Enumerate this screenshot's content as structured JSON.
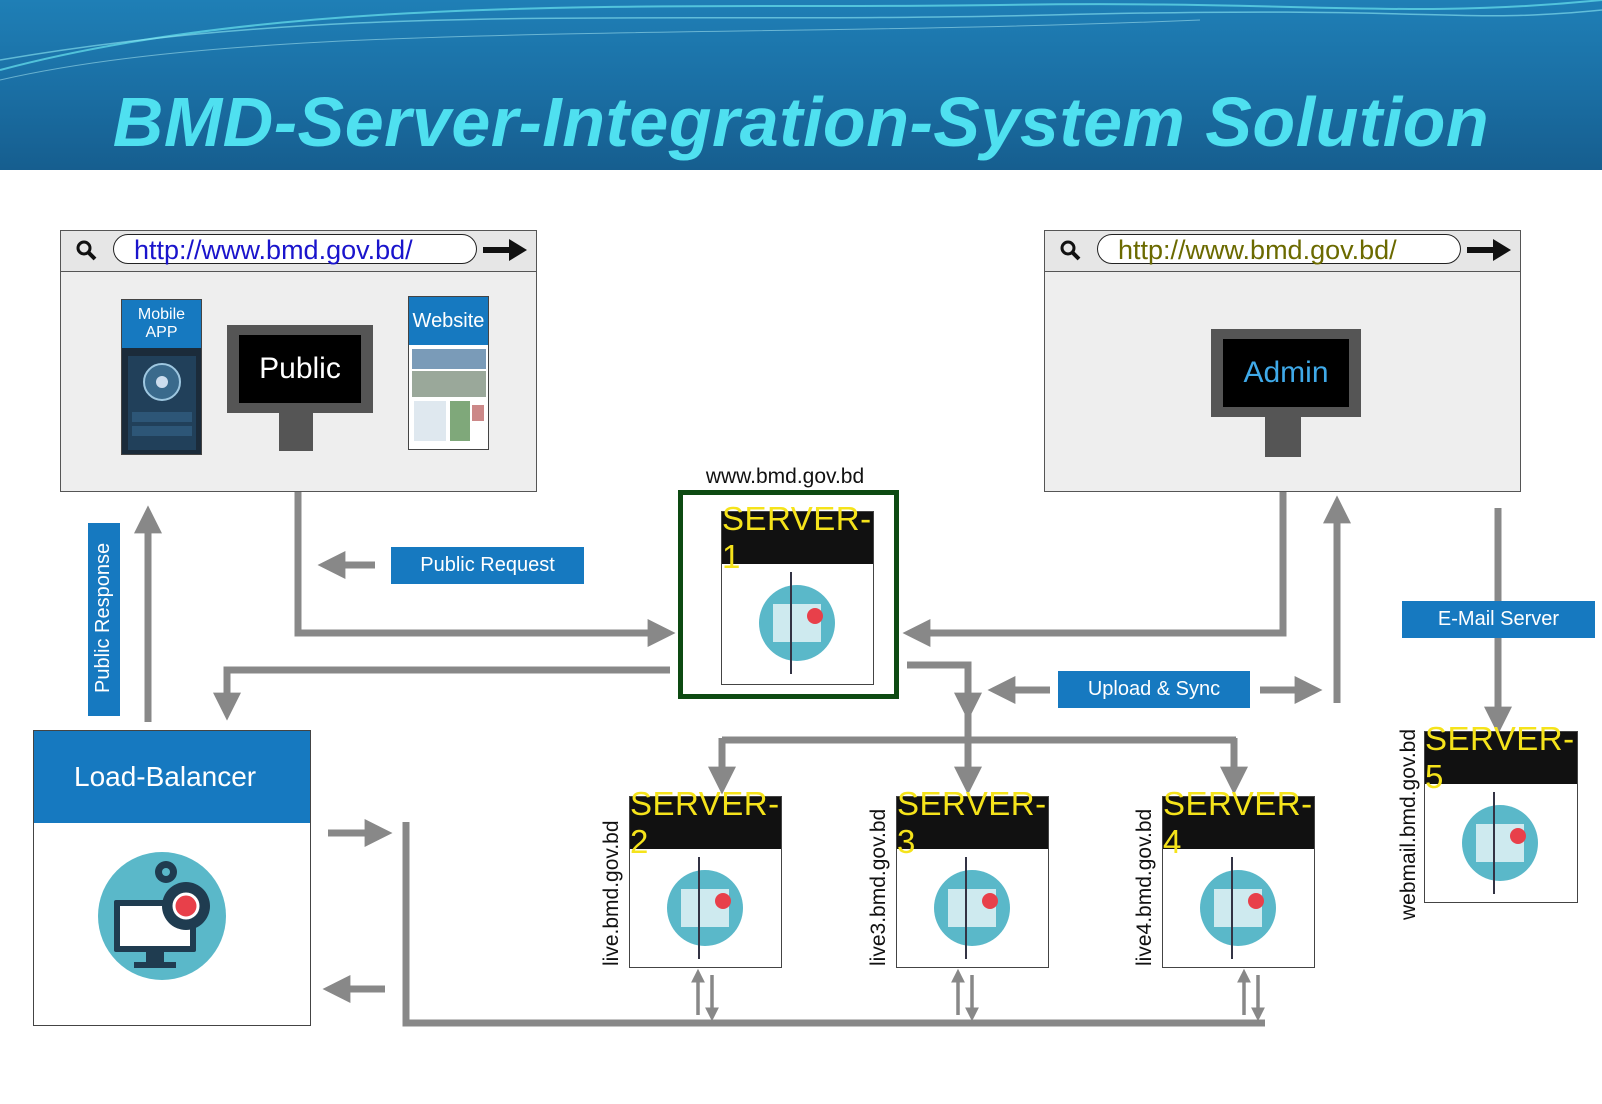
{
  "title": "BMD-Server-Integration-System Solution",
  "public_browser": {
    "url": "http://www.bmd.gov.bd/",
    "mobile_app_label": "Mobile APP",
    "monitor_label": "Public",
    "website_label": "Website"
  },
  "admin_browser": {
    "url": "http://www.bmd.gov.bd/",
    "monitor_label": "Admin"
  },
  "labels": {
    "public_request": "Public Request",
    "public_response": "Public Response",
    "upload_sync": "Upload & Sync",
    "email_server": "E-Mail Server",
    "load_balancer": "Load-Balancer"
  },
  "servers": [
    {
      "name": "SERVER-1",
      "domain": "www.bmd.gov.bd"
    },
    {
      "name": "SERVER-2",
      "domain": "live.bmd.gov.bd"
    },
    {
      "name": "SERVER-3",
      "domain": "live3.bmd.gov.bd"
    },
    {
      "name": "SERVER-4",
      "domain": "live4.bmd.gov.bd"
    },
    {
      "name": "SERVER-5",
      "domain": "webmail.bmd.gov.bd"
    }
  ],
  "colors": {
    "header": "#1a6ea3",
    "title": "#4fe0f0",
    "label_blue": "#1679c0",
    "server_head_text": "#f5e31b",
    "server1_border": "#0d4a12",
    "arrow": "#888888",
    "admin_url": "#6b6a00",
    "public_url": "#1a14cc"
  }
}
